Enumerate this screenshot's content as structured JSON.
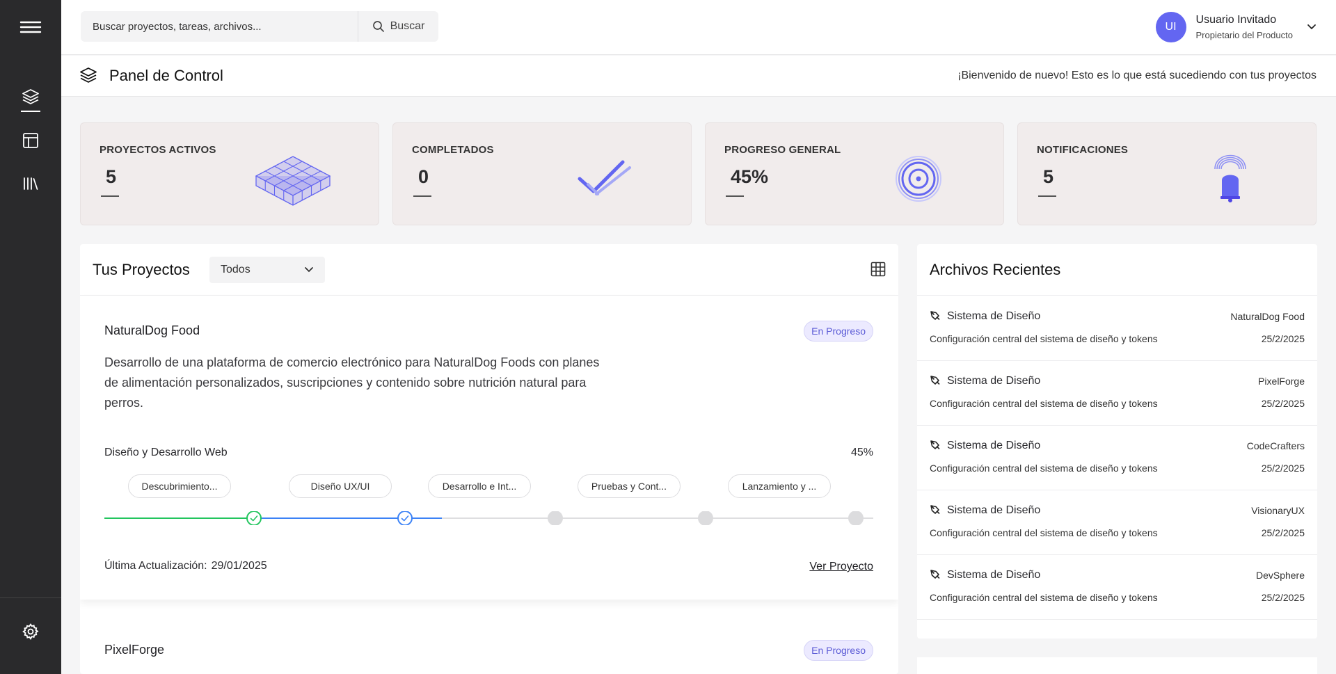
{
  "search": {
    "placeholder": "Buscar proyectos, tareas, archivos...",
    "button_label": "Buscar"
  },
  "user": {
    "initials": "UI",
    "name": "Usuario Invitado",
    "role": "Propietario del Producto"
  },
  "header": {
    "title": "Panel de Control",
    "welcome": "¡Bienvenido de nuevo! Esto es lo que está sucediendo con tus proyectos"
  },
  "stats": [
    {
      "label": "PROYECTOS ACTIVOS",
      "value": "5",
      "icon": "cube-grid-icon"
    },
    {
      "label": "COMPLETADOS",
      "value": "0",
      "icon": "double-check-icon"
    },
    {
      "label": "PROGRESO GENERAL",
      "value": "45%",
      "icon": "target-icon"
    },
    {
      "label": "NOTIFICACIONES",
      "value": "5",
      "icon": "bell-icon"
    }
  ],
  "projects": {
    "title": "Tus Proyectos",
    "filter": "Todos",
    "items": [
      {
        "name": "NaturalDog Food",
        "status": "En Progreso",
        "description": "Desarrollo de una plataforma de comercio electrónico para NaturalDog Foods con planes de alimentación personalizados, suscripciones y contenido sobre nutrición natural para perros.",
        "phase": "Diseño y Desarrollo Web",
        "progress_label": "45%",
        "progress": 0.45,
        "steps": [
          "Descubrimiento...",
          "Diseño UX/UI",
          "Desarrollo e Int...",
          "Pruebas y Cont...",
          "Lanzamiento y ..."
        ],
        "last_update_label": "Última Actualización:",
        "last_update": "29/01/2025",
        "view_label": "Ver Proyecto"
      },
      {
        "name": "PixelForge",
        "status": "En Progreso"
      }
    ]
  },
  "files": {
    "title": "Archivos Recientes",
    "items": [
      {
        "name": "Sistema de Diseño",
        "project": "NaturalDog Food",
        "desc": "Configuración central del sistema de diseño y tokens",
        "date": "25/2/2025"
      },
      {
        "name": "Sistema de Diseño",
        "project": "PixelForge",
        "desc": "Configuración central del sistema de diseño y tokens",
        "date": "25/2/2025"
      },
      {
        "name": "Sistema de Diseño",
        "project": "CodeCrafters",
        "desc": "Configuración central del sistema de diseño y tokens",
        "date": "25/2/2025"
      },
      {
        "name": "Sistema de Diseño",
        "project": "VisionaryUX",
        "desc": "Configuración central del sistema de diseño y tokens",
        "date": "25/2/2025"
      },
      {
        "name": "Sistema de Diseño",
        "project": "DevSphere",
        "desc": "Configuración central del sistema de diseño y tokens",
        "date": "25/2/2025"
      }
    ]
  },
  "colors": {
    "accent": "#6366f1",
    "sidebar": "#2a2a2c",
    "step_done": "#22c55e",
    "step_active": "#3b82f6",
    "card_bg": "#f1ecec"
  }
}
